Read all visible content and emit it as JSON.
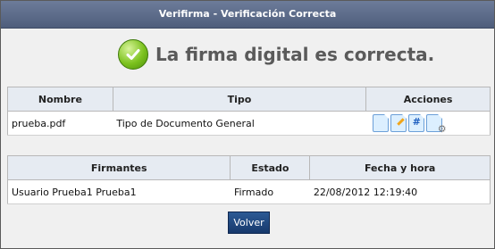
{
  "window": {
    "title": "Verifirma - Verificación Correcta"
  },
  "message": {
    "text": "La firma digital es correcta."
  },
  "documents": {
    "headers": [
      "Nombre",
      "Tipo",
      "Acciones"
    ],
    "rows": [
      {
        "nombre": "prueba.pdf",
        "tipo": "Tipo de Documento General"
      }
    ],
    "action_icons": [
      "view-document-icon",
      "sign-document-icon",
      "hash-document-icon",
      "settings-document-icon"
    ]
  },
  "signers": {
    "headers": [
      "Firmantes",
      "Estado",
      "Fecha y hora"
    ],
    "rows": [
      {
        "firmante": "Usuario Prueba1 Prueba1",
        "estado": "Firmado",
        "fecha": "22/08/2012 12:19:40"
      }
    ]
  },
  "buttons": {
    "back": "Volver"
  },
  "colors": {
    "titlebar": "#5c6a87",
    "button": "#1f477f",
    "check": "#7cc21e"
  }
}
